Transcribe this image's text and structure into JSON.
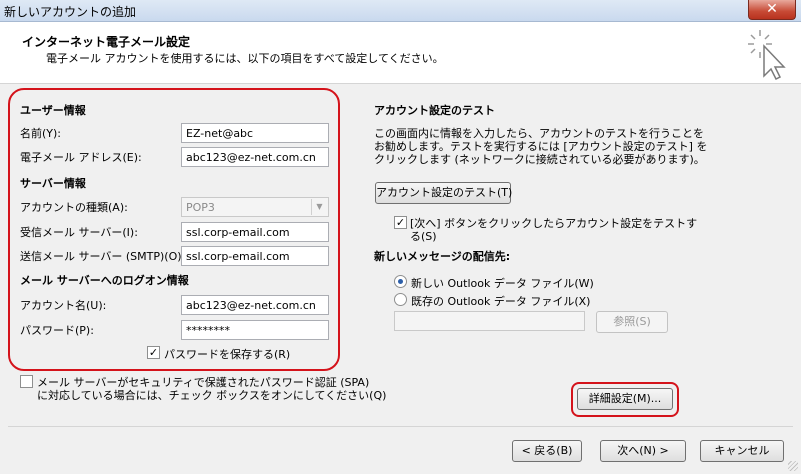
{
  "window": {
    "title": "新しいアカウントの追加",
    "close_label": "✕"
  },
  "header": {
    "title": "インターネット電子メール設定",
    "subtitle": "電子メール アカウントを使用するには、以下の項目をすべて設定してください。"
  },
  "user_info": {
    "heading": "ユーザー情報",
    "name_label": "名前(Y):",
    "name_value": "EZ-net@abc",
    "email_label": "電子メール アドレス(E):",
    "email_value": "abc123@ez-net.com.cn"
  },
  "server_info": {
    "heading": "サーバー情報",
    "account_type_label": "アカウントの種類(A):",
    "account_type_value": "POP3",
    "incoming_label": "受信メール サーバー(I):",
    "incoming_value": "ssl.corp-email.com",
    "outgoing_label": "送信メール サーバー (SMTP)(O):",
    "outgoing_value": "ssl.corp-email.com"
  },
  "logon_info": {
    "heading": "メール サーバーへのログオン情報",
    "account_name_label": "アカウント名(U):",
    "account_name_value": "abc123@ez-net.com.cn",
    "password_label": "パスワード(P):",
    "password_value": "********",
    "remember_password_label": "パスワードを保存する(R)",
    "remember_password_checked": true
  },
  "spa": {
    "label_line1": "メール サーバーがセキュリティで保護されたパスワード認証 (SPA)",
    "label_line2": "に対応している場合には、チェック ボックスをオンにしてください(Q)",
    "checked": false
  },
  "test": {
    "heading": "アカウント設定のテスト",
    "desc_line1": "この画面内に情報を入力したら、アカウントのテストを行うことを",
    "desc_line2": "お勧めします。テストを実行するには [アカウント設定のテスト] を",
    "desc_line3": "クリックします (ネットワークに接続されている必要があります)。",
    "test_button": "アカウント設定のテスト(T)",
    "auto_test_line1": "[次へ] ボタンをクリックしたらアカウント設定をテストす",
    "auto_test_line2": "る(S)",
    "auto_test_checked": true
  },
  "delivery": {
    "heading": "新しいメッセージの配信先:",
    "new_file_label": "新しい Outlook データ ファイル(W)",
    "existing_file_label": "既存の Outlook データ ファイル(X)",
    "selected": "new",
    "path_value": "",
    "browse_button": "参照(S)"
  },
  "more_settings_button": "詳細設定(M)...",
  "footer": {
    "back_button": "< 戻る(B)",
    "next_button": "次へ(N) >",
    "cancel_button": "キャンセル"
  },
  "colors": {
    "annotation_red": "#d4131b",
    "radio_dot": "#2c5ea8"
  }
}
